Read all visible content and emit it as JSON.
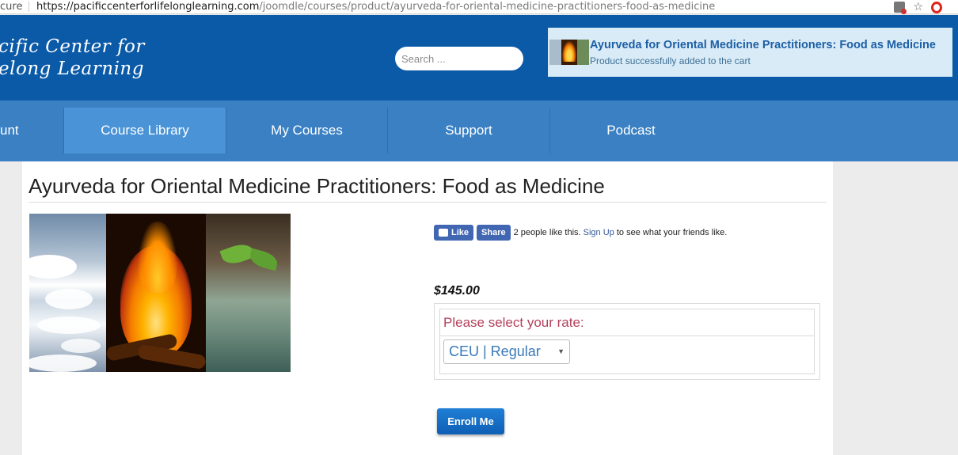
{
  "browser": {
    "secure_label": "cure",
    "url_host": "https://pacificcenterforlifelonglearning.com",
    "url_path": "/joomdle/courses/product/ayurveda-for-oriental-medicine-practitioners-food-as-medicine",
    "icons": [
      "translate-icon",
      "star-icon",
      "opera-icon"
    ]
  },
  "header": {
    "logo_line1": "cific Center for",
    "logo_line2": "elong Learning",
    "search_placeholder": "Search ...",
    "cart_notice": {
      "title": "Ayurveda for Oriental Medicine Practitioners: Food as Medicine",
      "message": "Product successfully added to the cart"
    }
  },
  "nav": {
    "items": [
      {
        "label": "unt"
      },
      {
        "label": "Course Library",
        "active": true
      },
      {
        "label": "My Courses"
      },
      {
        "label": "Support"
      },
      {
        "label": "Podcast"
      }
    ]
  },
  "main": {
    "title": "Ayurveda for Oriental Medicine Practitioners: Food as Medicine",
    "facebook": {
      "like_label": "Like",
      "share_label": "Share",
      "text_before": "2 people like this.",
      "signup_link": "Sign Up",
      "text_after": "to see what your friends like."
    },
    "price": "$145.00",
    "rate": {
      "label": "Please select your rate:",
      "selected": "CEU | Regular"
    },
    "enroll_label": "Enroll Me"
  },
  "colors": {
    "header_bg": "#0a5aa8",
    "nav_bg": "#3a80c3",
    "nav_active": "#4a93d6",
    "cart_notice_bg": "#d9ebf7",
    "rate_label": "#b3415b",
    "enroll_button": "#0e5fb5"
  }
}
